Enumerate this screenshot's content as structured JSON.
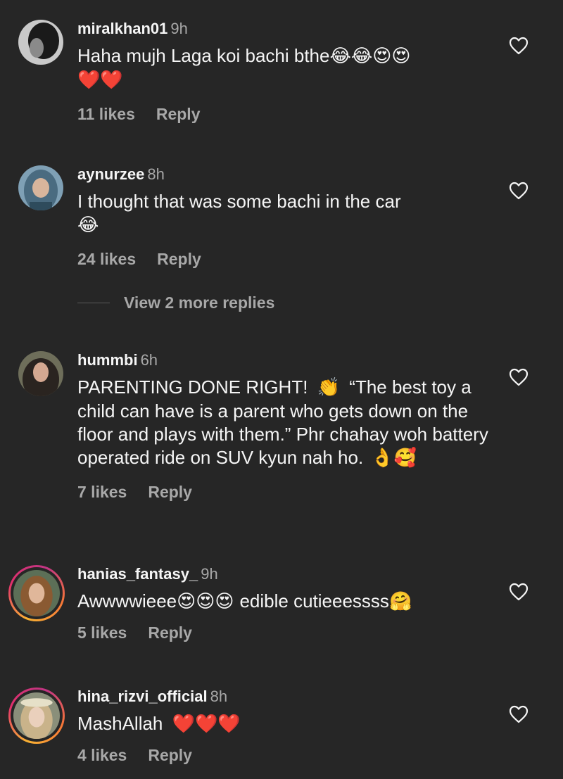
{
  "comments": [
    {
      "username": "miralkhan01",
      "time": "9h",
      "text": "Haha mujh Laga koi bachi bthe",
      "emojis": "😂😂😍😍",
      "emojis2": "❤️❤️",
      "likes": "11 likes",
      "reply": "Reply"
    },
    {
      "username": "aynurzee",
      "time": "8h",
      "text": "I thought that was some bachi in the car",
      "emojis": "😂",
      "likes": "24 likes",
      "reply": "Reply",
      "view_more": "View 2 more replies"
    },
    {
      "username": "hummbi",
      "time": "6h",
      "text_a": "PARENTING DONE RIGHT!",
      "emoji_a": "👏",
      "text_b": "“The best toy a child can have is a parent who gets down on the floor and plays with them.” Phr chahay woh battery operated ride on SUV kyun nah ho.",
      "emoji_b": "👌🥰",
      "likes": "7 likes",
      "reply": "Reply"
    },
    {
      "username": "hanias_fantasy_",
      "time": "9h",
      "text_a": "Awwwwieee",
      "emoji_a": "😍😍😍",
      "text_b": "edible cutieeessss",
      "emoji_b": "🤗",
      "likes": "5 likes",
      "reply": "Reply"
    },
    {
      "username": "hina_rizvi_official",
      "time": "8h",
      "text": "MashAllah",
      "emojis": "❤️❤️❤️",
      "likes": "4 likes",
      "reply": "Reply"
    }
  ],
  "icons": {
    "like": "heart-outline-icon"
  },
  "colors": {
    "background": "#262626",
    "primary_text": "#f5f5f5",
    "secondary_text": "#a8a8a8"
  }
}
